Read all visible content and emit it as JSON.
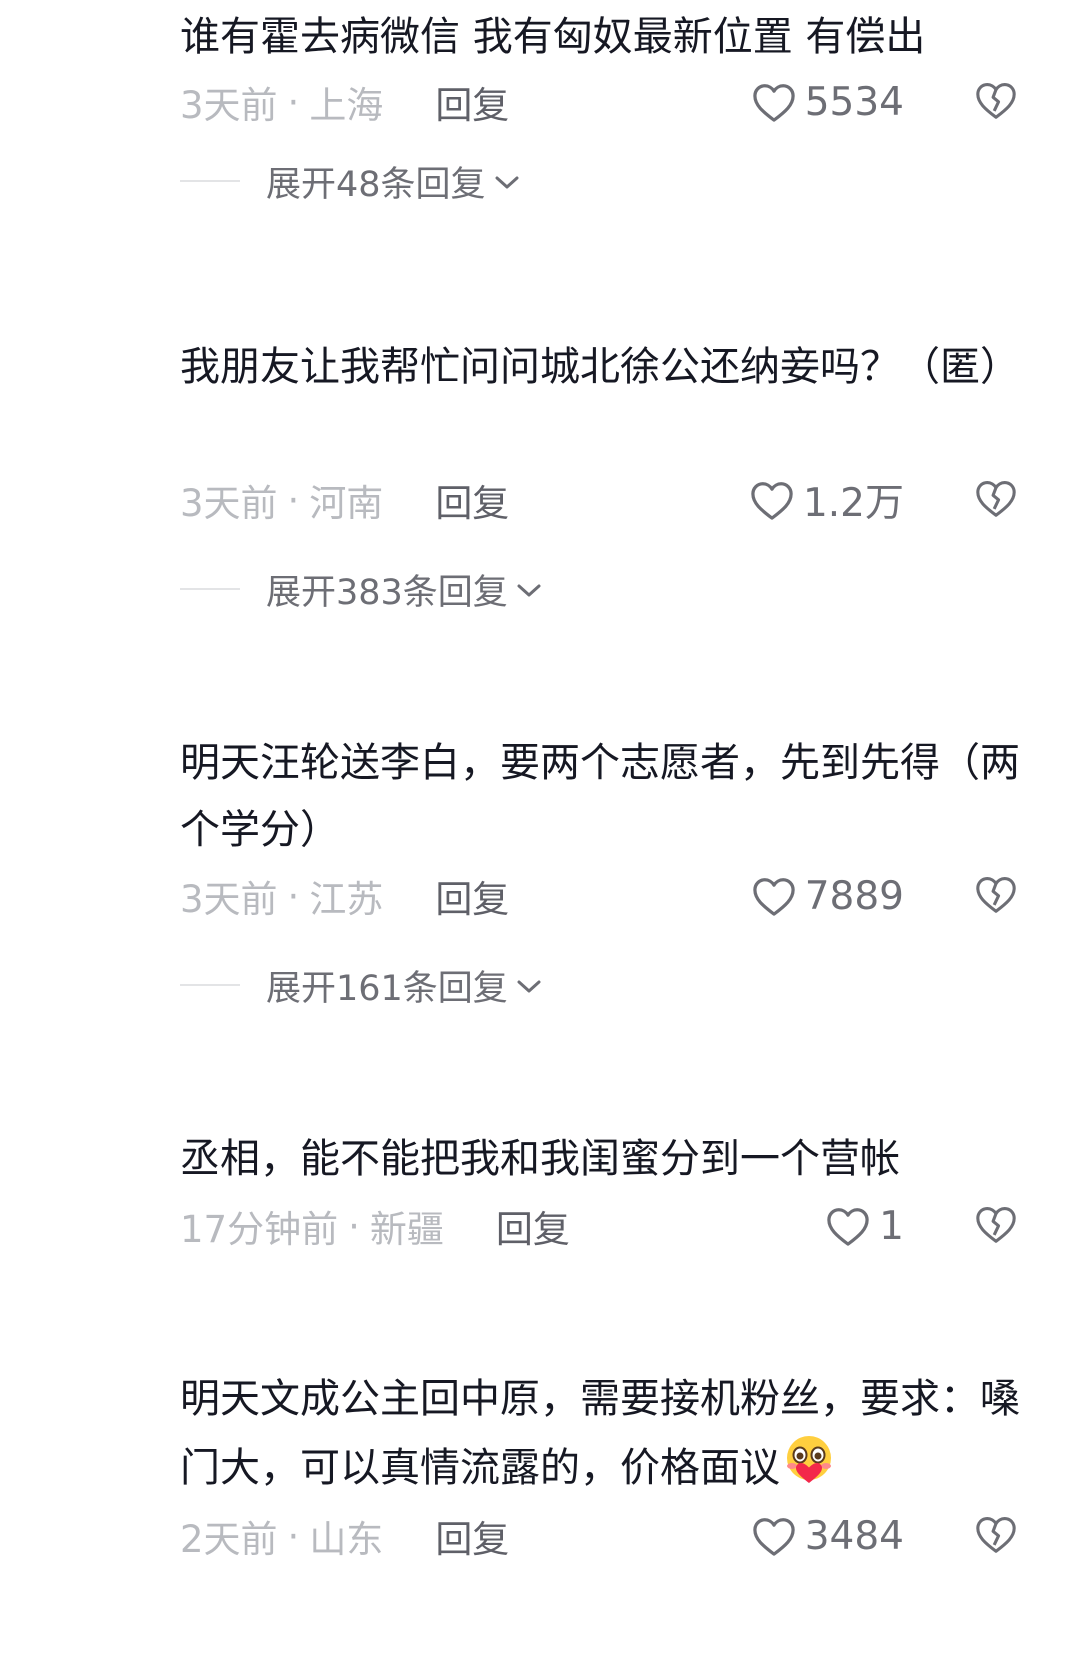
{
  "comments": [
    {
      "text": "谁有霍去病微信 我有匈奴最新位置 有偿出",
      "time": "3天前",
      "location": "上海",
      "reply_label": "回复",
      "likes": "5534",
      "expand_label": "展开48条回复"
    },
    {
      "text": "我朋友让我帮忙问问城北徐公还纳妾吗？（匿）",
      "time": "3天前",
      "location": "河南",
      "reply_label": "回复",
      "likes": "1.2万",
      "expand_label": "展开383条回复"
    },
    {
      "text": "明天汪轮送李白，要两个志愿者，先到先得（两个学分）",
      "time": "3天前",
      "location": "江苏",
      "reply_label": "回复",
      "likes": "7889",
      "expand_label": "展开161条回复"
    },
    {
      "text": "丞相，能不能把我和我闺蜜分到一个营帐",
      "time": "17分钟前",
      "location": "新疆",
      "reply_label": "回复",
      "likes": "1"
    },
    {
      "text": "明天文成公主回中原，需要接机粉丝，要求：嗓门大，可以真情流露的，价格面议",
      "time": "2天前",
      "location": "山东",
      "reply_label": "回复",
      "likes": "3484"
    }
  ],
  "meta_separator": "·",
  "icons": {
    "like": "heart-outline-icon",
    "dislike": "broken-heart-icon",
    "expand": "chevron-down-icon",
    "emoji": "blushing-heart-emoji"
  }
}
